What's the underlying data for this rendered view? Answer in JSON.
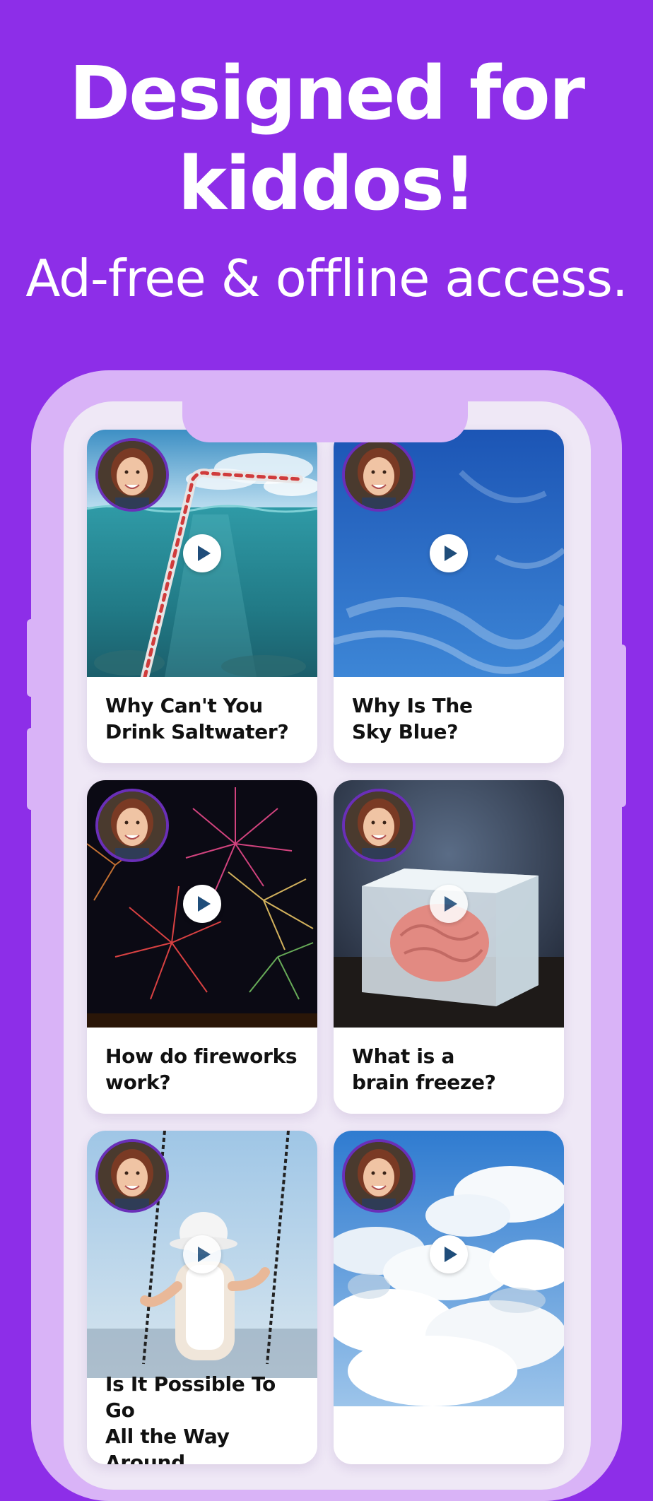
{
  "header": {
    "headline_line1": "Designed for",
    "headline_line2": "kiddos!",
    "subheadline": "Ad-free & offline access."
  },
  "videos": [
    {
      "title_line1": "Why Can't You",
      "title_line2": "Drink Saltwater?",
      "thumbnail": "straw-in-ocean"
    },
    {
      "title_line1": "Why Is The",
      "title_line2": "Sky Blue?",
      "thumbnail": "blue-sky"
    },
    {
      "title_line1": "How do fireworks",
      "title_line2": "work?",
      "thumbnail": "fireworks"
    },
    {
      "title_line1": "What is a",
      "title_line2": "brain freeze?",
      "thumbnail": "brain-in-ice"
    },
    {
      "title_line1": "Is It Possible To Go",
      "title_line2": "All the Way Around",
      "thumbnail": "child-on-swing"
    },
    {
      "title_line1": "",
      "title_line2": "",
      "thumbnail": "clouds"
    }
  ],
  "colors": {
    "background": "#8d2ee8",
    "phone_frame": "#d9b3f7",
    "screen": "#efe8f6",
    "avatar_ring": "#6a2fb8",
    "play_icon": "#1f4d7a"
  }
}
